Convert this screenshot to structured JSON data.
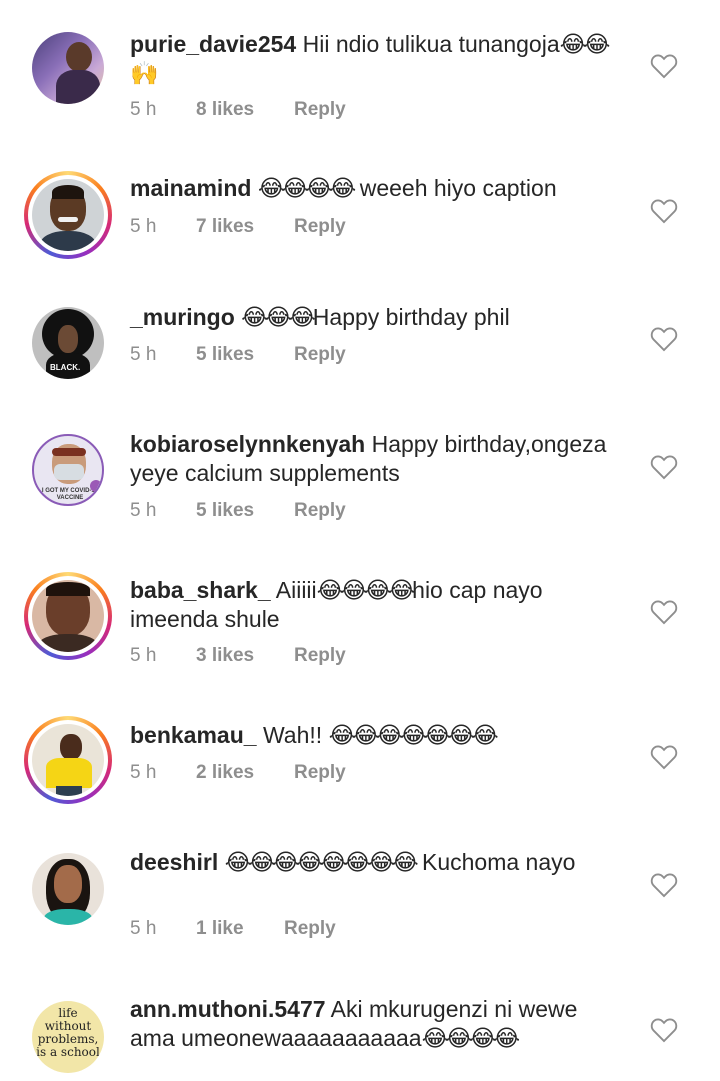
{
  "comments": [
    {
      "username": "purie_davie254",
      "text": "Hii ndio tulikua tunangoja",
      "emoji": "😂😂🙌",
      "time": "5 h",
      "likes": "8 likes",
      "reply": "Reply"
    },
    {
      "username": "mainamind",
      "text": "weeeh hiyo caption",
      "emoji": "😂😂😂😂",
      "time": "5 h",
      "likes": "7 likes",
      "reply": "Reply"
    },
    {
      "username": "_muringo",
      "text": "Happy birthday phil",
      "emoji": "😂😂😂",
      "time": "5 h",
      "likes": "5 likes",
      "reply": "Reply"
    },
    {
      "username": "kobiaroselynnkenyah",
      "text": "Happy birthday,ongeza yeye calcium supplements",
      "emoji": "",
      "time": "5 h",
      "likes": "5 likes",
      "reply": "Reply"
    },
    {
      "username": "baba_shark_",
      "text": "Aiiiii",
      "emoji": "😂😂😂😂",
      "text2": "hio cap nayo imeenda shule",
      "time": "5 h",
      "likes": "3 likes",
      "reply": "Reply"
    },
    {
      "username": "benkamau_",
      "text": "Wah!!",
      "emoji": "😂😂😂😂😂😂😂",
      "time": "5 h",
      "likes": "2 likes",
      "reply": "Reply"
    },
    {
      "username": "deeshirl",
      "text": "Kuchoma nayo",
      "emoji": "😂😂😂😂😂😂😂😂",
      "time": "5 h",
      "likes": "1 like",
      "reply": "Reply"
    },
    {
      "username": "ann.muthoni.5477",
      "text": "Aki mkurugenzi ni wewe ama umeonewaaaaaaaaaaa",
      "emoji": "😂😂😂😂",
      "time": "",
      "likes": "",
      "reply": ""
    }
  ],
  "avatar_text": {
    "muringo": "BLACK.",
    "kobia": "I GOT MY COVID-19 VACCINE",
    "ann": "life without problems, is a school"
  }
}
